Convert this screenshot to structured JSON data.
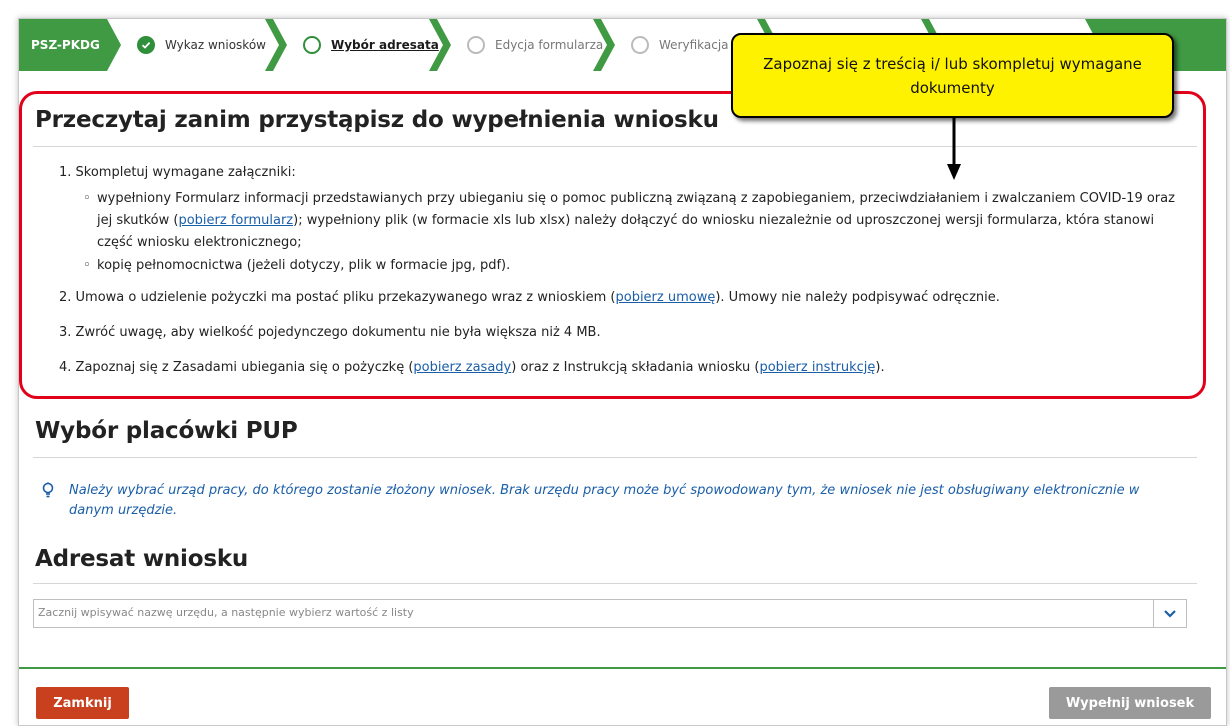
{
  "steps": {
    "code": "PSZ-PKDG",
    "items": [
      {
        "label": "Wykaz wniosków",
        "state": "done"
      },
      {
        "label": "Wybór adresata",
        "state": "active"
      },
      {
        "label": "Edycja formularza",
        "state": "todo"
      },
      {
        "label": "Weryfikacja ko",
        "state": "todo"
      }
    ]
  },
  "callout": {
    "text": "Zapoznaj się z treścią i/ lub skompletuj wymagane dokumenty"
  },
  "read_section": {
    "title": "Przeczytaj zanim przystąpisz do wypełnienia wniosku",
    "item1": "1. Skompletuj wymagane załączniki:",
    "sub1_a": "wypełniony Formularz informacji przedstawianych przy ubieganiu się o pomoc publiczną związaną z zapobieganiem, przeciwdziałaniem i zwalczaniem COVID-19 oraz jej skutków (",
    "sub1_link": "pobierz formularz",
    "sub1_b": "); wypełniony plik (w formacie xls lub xlsx) należy dołączyć do wniosku niezależnie od uproszczonej wersji formularza, która stanowi część wniosku elektronicznego;",
    "sub2": "kopię pełnomocnictwa (jeżeli dotyczy, plik w formacie jpg, pdf).",
    "item2_a": "2. Umowa o udzielenie pożyczki ma postać pliku przekazywanego wraz z wnioskiem (",
    "item2_link": "pobierz umowę",
    "item2_b": "). Umowy nie należy podpisywać odręcznie.",
    "item3": "3. Zwróć uwagę, aby wielkość pojedynczego dokumentu nie była większa niż 4 MB.",
    "item4_a": "4. Zapoznaj się z Zasadami ubiegania się o pożyczkę (",
    "item4_link1": "pobierz zasady",
    "item4_b": ") oraz z Instrukcją składania wniosku (",
    "item4_link2": "pobierz instrukcję",
    "item4_c": ")."
  },
  "pup_section": {
    "title": "Wybór placówki PUP",
    "info": "Należy wybrać urząd pracy, do którego zostanie złożony wniosek. Brak urzędu pracy może być spowodowany tym, że wniosek nie jest obsługiwany elektronicznie w danym urzędzie."
  },
  "address_section": {
    "title": "Adresat wniosku",
    "placeholder": "Zacznij wpisywać nazwę urzędu, a następnie wybierz wartość z listy"
  },
  "footer": {
    "close_label": "Zamknij",
    "fill_label": "Wypełnij wniosek"
  },
  "colors": {
    "green": "#3f9a43",
    "callout_yellow": "#fff200",
    "highlight_red": "#e3001b",
    "close_button": "#c8401e",
    "link_blue": "#1a5ea8"
  }
}
